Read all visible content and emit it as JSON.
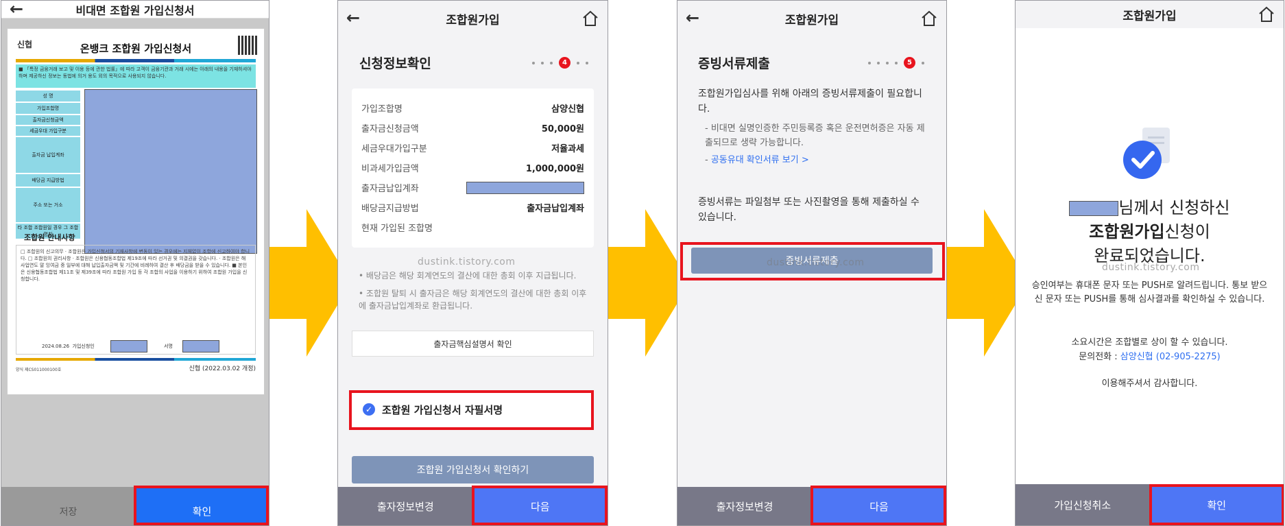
{
  "colors": {
    "arrow": "#ffbf00",
    "highlight": "#e8141e",
    "primary": "#1e6ff6",
    "link": "#2f6ff0"
  },
  "screen1": {
    "header_title": "비대면 조합원 가입신청서",
    "doc_logo": "신협",
    "doc_title": "온뱅크 조합원 가입신청서",
    "doc_notice": "■ 「특정 금융거래 보고 및 이용 등에 관한 법률」에 따라 고객이 금융기관과 거래 시에는 아래의 내용을 기재하셔야 하며 제공하신 정보는 동법에 의거 용도 외의 목적으로 사용되지 않습니다.",
    "doc_labels": [
      "성 명",
      "가입조합명",
      "출자금신청금액",
      "세금우대 가입구분",
      "출자금 납입계좌",
      "배당금 지급방법",
      "주소 또는 거소",
      "타 조합 조합원일 경우 그 조합 명칭"
    ],
    "doc_section": "조합원 안내사항",
    "doc_fine": "□ 조합원의 신고의무 · 조합원은 가입신청서의 기재사항에 변동이 있는 경우에는 지체없이 조합에 신고하여야 합니다. □ 조합원의 권리사항 · 조합원은 신용협동조합법 제19조에 따라 선거권 및 의결권을 갖습니다. · 조합원은 해 사업연도 말 잉여금 중 일부에 대해 납입출자금액 및 기간에 비례하여 결산 후 배당금을 받을 수 있습니다. ■ 본인은 신용협동조합법 제11조 및 제39조에 따라 조합원 가입 등 각 조합의 사업을 이용하기 위하여 조합원 가입을 신청합니다.",
    "doc_date": "2024.08.26",
    "doc_sig_applicant": "가입신청인",
    "doc_sig_sign": "서명",
    "doc_form_no": "양식 제CS011000100호",
    "doc_footer_logo": "신협 (2022.03.02 개정)",
    "save_label": "저장",
    "confirm_label": "확인"
  },
  "screen2": {
    "header_title": "조합원가입",
    "section_title": "신청정보확인",
    "current_step": "4",
    "rows": [
      {
        "key": "가입조합명",
        "value": "삼양신협"
      },
      {
        "key": "출자금신청금액",
        "value": "50,000원"
      },
      {
        "key": "세금우대가입구분",
        "value": "저율과세"
      },
      {
        "key": "비과세가입금액",
        "value": "1,000,000원"
      },
      {
        "key": "출자금납입계좌",
        "value": ""
      },
      {
        "key": "배당금지급방법",
        "value": "출자금납입계좌"
      },
      {
        "key": "현재 가입된 조합명",
        "value": ""
      }
    ],
    "watermark": "dustink.tistory.com",
    "note1": "배당금은 해당 회계연도의 결산에 대한 총회 이후 지급됩니다.",
    "note2": "조합원 탈퇴 시 출자금은 해당 회계연도의 결산에 대한 총회 이후에 출자금납입계좌로 환급됩니다.",
    "explain_button": "출자금핵심설명서 확인",
    "sign_label": "조합원 가입신청서 자필서명",
    "confirm_form_button": "조합원 가입신청서 확인하기",
    "bottom_left": "출자정보변경",
    "bottom_right": "다음"
  },
  "screen3": {
    "header_title": "조합원가입",
    "section_title": "증빙서류제출",
    "current_step": "5",
    "intro": "조합원가입심사를 위해 아래의 증빙서류제출이 필요합니다.",
    "note1": "비대면 실명인증한 주민등록증 혹은 운전면허증은 자동 제출되므로 생략 가능합니다.",
    "link_text": "공동유대 확인서류 보기",
    "method": "증빙서류는 파일첨부 또는 사진촬영을 통해 제출하실 수 있습니다.",
    "submit_button": "증빙서류제출",
    "watermark": "dustink.tistory.com",
    "bottom_left": "출자정보변경",
    "bottom_right": "다음"
  },
  "screen4": {
    "header_title": "조합원가입",
    "line1_suffix": "님께서 신청하신",
    "line2_bold": "조합원가입",
    "line2_rest": "신청이",
    "line3": "완료되었습니다.",
    "watermark": "dustink.tistory.com",
    "msg1": "승인여부는 휴대폰 문자 또는 PUSH로 알려드립니다. 통보 받으신 문자 또는 PUSH를 통해 심사결과를 확인하실 수 있습니다.",
    "msg2": "소요시간은 조합별로 상이 할 수 있습니다.",
    "phone_label": "문의전화 :",
    "phone_value": "삼양신협 (02-905-2275)",
    "msg3": "이용해주셔서 감사합니다.",
    "bottom_left": "가입신청취소",
    "bottom_right": "확인"
  }
}
